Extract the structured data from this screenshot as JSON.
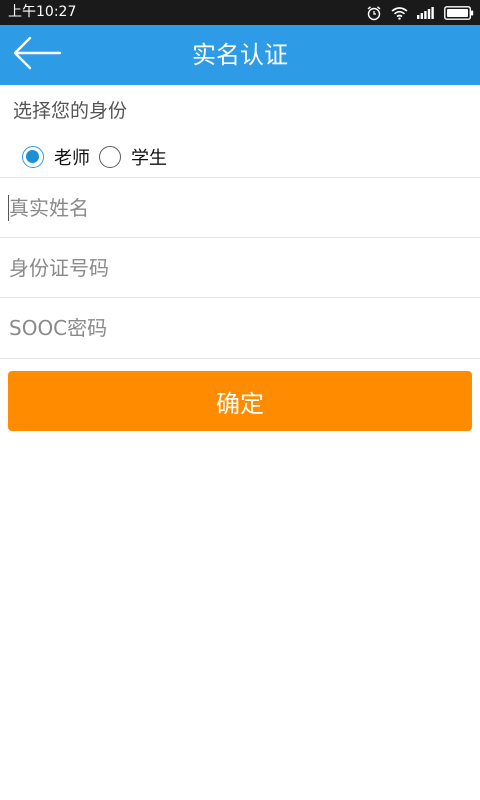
{
  "status_bar": {
    "time": "上午10:27",
    "icons": [
      "alarm-icon",
      "wifi-icon",
      "signal-icon",
      "battery-icon"
    ]
  },
  "app_bar": {
    "title": "实名认证",
    "back_icon": "back-arrow-icon",
    "background_color": "#2e9be6"
  },
  "identity": {
    "label": "选择您的身份",
    "options": [
      {
        "label": "老师",
        "selected": true
      },
      {
        "label": "学生",
        "selected": false
      }
    ]
  },
  "form": {
    "fields": [
      {
        "placeholder": "真实姓名",
        "value": ""
      },
      {
        "placeholder": "身份证号码",
        "value": ""
      },
      {
        "placeholder": "SOOC密码",
        "value": ""
      }
    ]
  },
  "confirm": {
    "label": "确定",
    "color": "#ff8c00"
  }
}
